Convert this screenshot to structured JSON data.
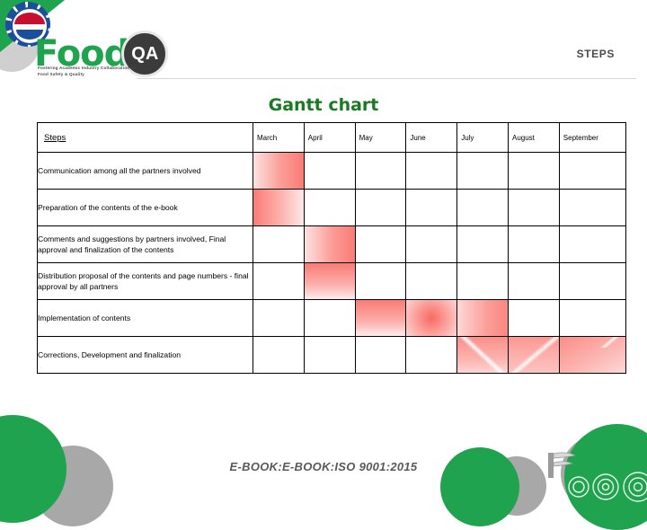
{
  "header": {
    "logo_food": "Food",
    "logo_qa": "QA",
    "logo_tagline": "Fostering Academic Industry Collaboration in Food Safety & Quality",
    "section_label": "STEPS"
  },
  "title": "Gantt chart",
  "footer": "E-BOOK:E-BOOK:ISO 9001:2015",
  "colors": {
    "brand_green": "#1FA34E",
    "title_green": "#1a7a23",
    "bar_red": "#fa7b75",
    "bar_red_light": "#fde2e1",
    "grey": "#a8a8a8",
    "text_grey": "#4a4a4a"
  },
  "chart_data": {
    "type": "table",
    "title": "Gantt chart",
    "columns": [
      "Steps",
      "March",
      "April",
      "May",
      "June",
      "July",
      "August",
      "September"
    ],
    "months": [
      "March",
      "April",
      "May",
      "June",
      "July",
      "August",
      "September"
    ],
    "rows": [
      {
        "task": "Communication among all the partners involved",
        "filled_months": [
          "March"
        ],
        "fills": [
          "h-light-to-dark"
        ]
      },
      {
        "task": "Preparation of the contents of the e-book",
        "filled_months": [
          "March"
        ],
        "fills": [
          "h-dark-to-light"
        ]
      },
      {
        "task": "Comments and suggestions by partners involved, Final approval and finalization of the contents",
        "filled_months": [
          "April"
        ],
        "fills": [
          "h-light-to-dark"
        ]
      },
      {
        "task": "Distribution proposal of the contents and page numbers - final approval by all partners",
        "filled_months": [
          "April"
        ],
        "fills": [
          "v-dark-to-light"
        ]
      },
      {
        "task": "Implementation of contents",
        "filled_months": [
          "May",
          "June",
          "July"
        ],
        "fills": [
          "v-dark-to-light",
          "radial",
          "h-light-to-dark2"
        ]
      },
      {
        "task": "Corrections, Development  and finalization",
        "filled_months": [
          "July",
          "August",
          "September"
        ],
        "fills": [
          "diag-a",
          "diag-b",
          "diag-c"
        ]
      }
    ]
  }
}
